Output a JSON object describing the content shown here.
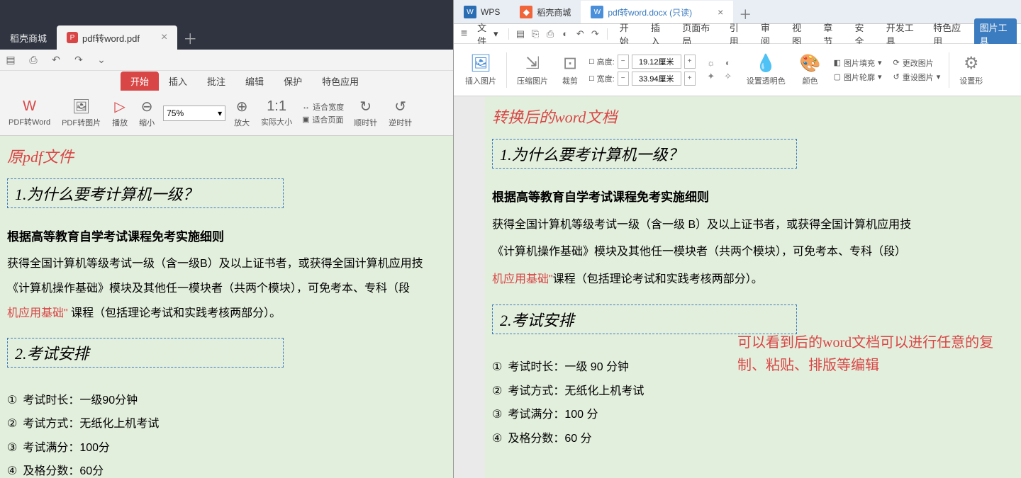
{
  "left": {
    "tabs": {
      "inactive": "稻壳商城",
      "active": "pdf转word.pdf",
      "close": "×",
      "add": "＋"
    },
    "ribbonTabs": {
      "start": "开始",
      "insert": "插入",
      "review": "批注",
      "edit": "编辑",
      "protect": "保护",
      "special": "特色应用"
    },
    "ribbon": {
      "pdf2word": "PDF转Word",
      "pdf2img": "PDF转图片",
      "play": "播放",
      "shrink": "缩小",
      "zoomVal": "75%",
      "enlarge": "放大",
      "actual": "实际大小",
      "fitWidth": "适合宽度",
      "fitPage": "适合页面",
      "cw": "顺时针",
      "ccw": "逆时针"
    }
  },
  "right": {
    "tabs": {
      "wps": "WPS",
      "dao": "稻壳商城",
      "active": "pdf转word.docx (只读)",
      "close": "×",
      "add": "＋"
    },
    "menu": {
      "file": "文件",
      "start": "开始",
      "insert": "插入",
      "layout": "页面布局",
      "ref": "引用",
      "review": "审阅",
      "view": "视图",
      "chapter": "章节",
      "security": "安全",
      "dev": "开发工具",
      "special": "特色应用",
      "imgTools": "图片工具"
    },
    "ribbon": {
      "insertImg": "插入图片",
      "compress": "压缩图片",
      "crop": "裁剪",
      "heightLab": "高度:",
      "heightVal": "19.12厘米",
      "widthLab": "宽度:",
      "widthVal": "33.94厘米",
      "transparent": "设置透明色",
      "color": "颜色",
      "fill": "图片填充",
      "outline": "图片轮廓",
      "change": "更改图片",
      "reset": "重设图片",
      "settings": "设置形"
    }
  },
  "doc": {
    "leftTag": "原pdf文件",
    "rightTag": "转换后的word文档",
    "h1": "1.为什么要考计算机一级？",
    "sub": "根据高等教育自学考试课程免考实施细则",
    "bodyL": "获得全国计算机等级考试一级（含一级B）及以上证书者，或获得全国计算机应用技\n《计算机操作基础》模块及其他任一模块者（共两个模块），可免考本、专科（段",
    "bodyR": "获得全国计算机等级考试一级（含一级 B）及以上证书者，或获得全国计算机应用技\n《计算机操作基础》模块及其他任一模块者（共两个模块），可免考本、专科（段）",
    "redPartL": "机应用基础\"",
    "afterRedL": " 课程（包括理论考试和实践考核两部分）。",
    "redPartR": "机应用基础\"",
    "afterRedR": "课程（包括理论考试和实践考核两部分）。",
    "h2": "2.考试安排",
    "listL": {
      "i1": "考试时长：一级90分钟",
      "i2": "考试方式：无纸化上机考试",
      "i3": "考试满分：100分",
      "i4": "及格分数：60分"
    },
    "listR": {
      "i1": "考试时长：一级 90 分钟",
      "i2": "考试方式：无纸化上机考试",
      "i3": "考试满分：100 分",
      "i4": "及格分数：60 分"
    },
    "note": "可以看到后的word文档可以进行任意的复制、粘贴、排版等编辑"
  },
  "circ": {
    "c1": "①",
    "c2": "②",
    "c3": "③",
    "c4": "④"
  }
}
